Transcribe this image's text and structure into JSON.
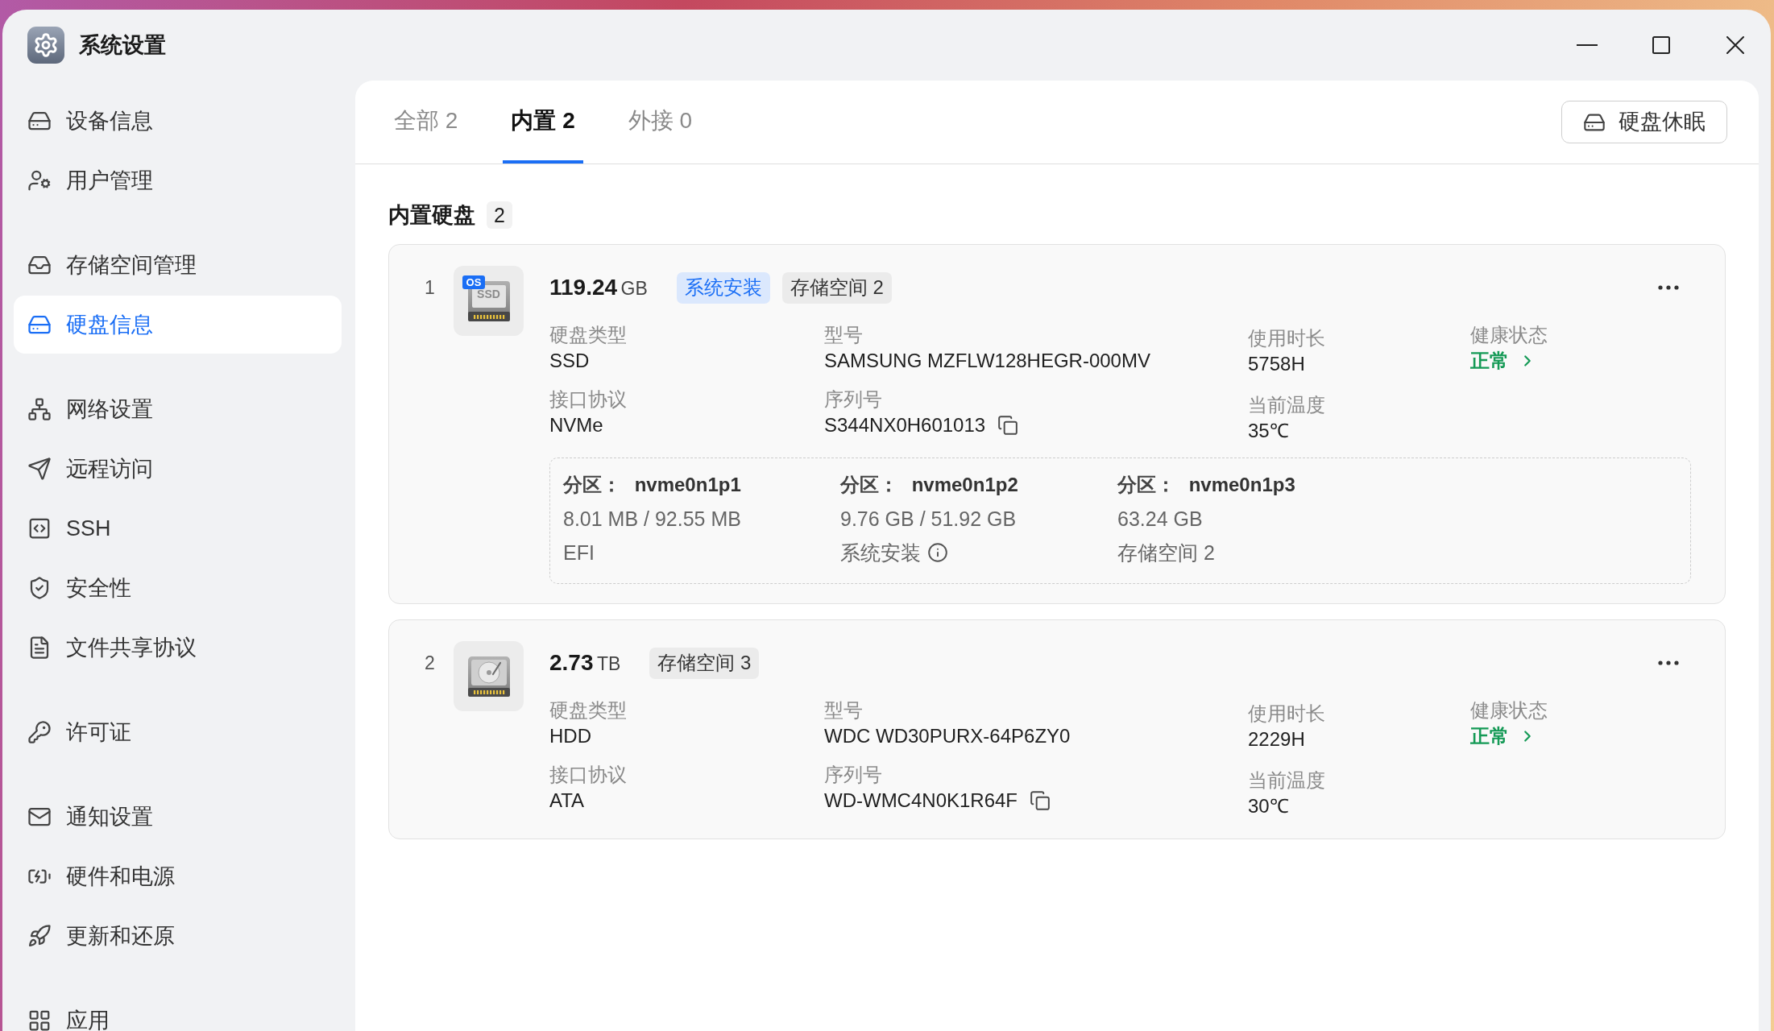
{
  "window": {
    "title": "系统设置"
  },
  "sidebar": {
    "groups": [
      {
        "items": [
          {
            "label": "设备信息",
            "selected": false
          },
          {
            "label": "用户管理",
            "selected": false
          }
        ]
      },
      {
        "items": [
          {
            "label": "存储空间管理",
            "selected": false
          },
          {
            "label": "硬盘信息",
            "selected": true
          }
        ]
      },
      {
        "items": [
          {
            "label": "网络设置",
            "selected": false
          },
          {
            "label": "远程访问",
            "selected": false
          },
          {
            "label": "SSH",
            "selected": false
          },
          {
            "label": "安全性",
            "selected": false
          },
          {
            "label": "文件共享协议",
            "selected": false
          }
        ]
      },
      {
        "items": [
          {
            "label": "许可证",
            "selected": false
          }
        ]
      },
      {
        "items": [
          {
            "label": "通知设置",
            "selected": false
          },
          {
            "label": "硬件和电源",
            "selected": false
          },
          {
            "label": "更新和还原",
            "selected": false
          }
        ]
      },
      {
        "items": [
          {
            "label": "应用",
            "selected": false
          }
        ]
      }
    ]
  },
  "tabs": [
    {
      "label": "全部 2",
      "selected": false
    },
    {
      "label": "内置 2",
      "selected": true
    },
    {
      "label": "外接 0",
      "selected": false
    }
  ],
  "toolbar": {
    "sleep_button": "硬盘休眠"
  },
  "section": {
    "title": "内置硬盘",
    "count": "2"
  },
  "disks": [
    {
      "number": "1",
      "kind": "ssd",
      "icon_badge": "OS",
      "icon_label": "SSD",
      "capacity": "119.24",
      "unit": "GB",
      "tags": [
        {
          "label": "系统安装",
          "kind": "system"
        },
        {
          "label": "存储空间 2",
          "kind": "storage"
        }
      ],
      "columns": [
        [
          {
            "label": "硬盘类型",
            "value": "SSD",
            "kind": "text"
          },
          {
            "label": "接口协议",
            "value": "NVMe",
            "kind": "text"
          }
        ],
        [
          {
            "label": "型号",
            "value": "SAMSUNG MZFLW128HEGR-000MV",
            "kind": "text"
          },
          {
            "label": "序列号",
            "value": "S344NX0H601013",
            "kind": "copy"
          }
        ],
        [
          {
            "label": "使用时长",
            "value": "5758H",
            "kind": "text"
          },
          {
            "label": "当前温度",
            "value": "35℃",
            "kind": "text"
          }
        ],
        [
          {
            "label": "健康状态",
            "value": "正常",
            "kind": "status"
          }
        ]
      ],
      "partitions": [
        {
          "label": "分区：",
          "name": "nvme0n1p1",
          "usage": "8.01 MB / 92.55 MB",
          "purpose": "EFI",
          "info": false
        },
        {
          "label": "分区：",
          "name": "nvme0n1p2",
          "usage": "9.76 GB / 51.92 GB",
          "purpose": "系统安装",
          "info": true
        },
        {
          "label": "分区：",
          "name": "nvme0n1p3",
          "usage": "63.24 GB",
          "purpose": "存储空间 2",
          "info": false
        }
      ]
    },
    {
      "number": "2",
      "kind": "hdd",
      "capacity": "2.73",
      "unit": "TB",
      "tags": [
        {
          "label": "存储空间 3",
          "kind": "storage"
        }
      ],
      "columns": [
        [
          {
            "label": "硬盘类型",
            "value": "HDD",
            "kind": "text"
          },
          {
            "label": "接口协议",
            "value": "ATA",
            "kind": "text"
          }
        ],
        [
          {
            "label": "型号",
            "value": "WDC WD30PURX-64P6ZY0",
            "kind": "text"
          },
          {
            "label": "序列号",
            "value": "WD-WMC4N0K1R64F",
            "kind": "copy"
          }
        ],
        [
          {
            "label": "使用时长",
            "value": "2229H",
            "kind": "text"
          },
          {
            "label": "当前温度",
            "value": "30℃",
            "kind": "text"
          }
        ],
        [
          {
            "label": "健康状态",
            "value": "正常",
            "kind": "status"
          }
        ]
      ]
    }
  ]
}
